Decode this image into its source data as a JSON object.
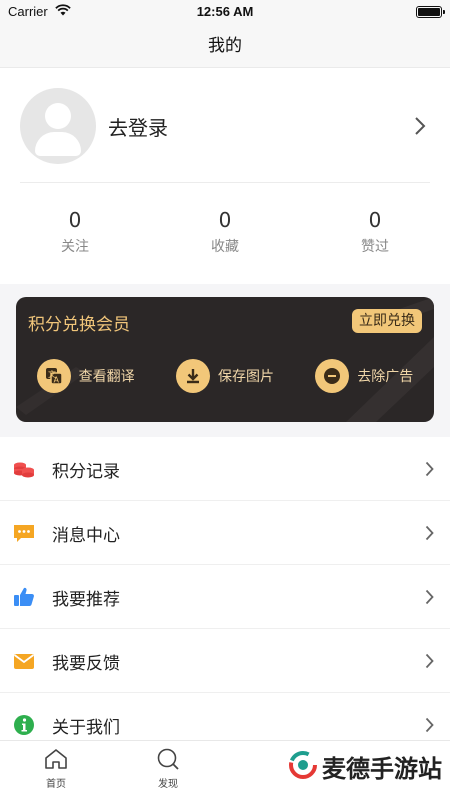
{
  "status_bar": {
    "carrier": "Carrier",
    "time": "12:56 AM"
  },
  "nav": {
    "title": "我的"
  },
  "profile": {
    "login_text": "去登录",
    "stats": [
      {
        "value": "0",
        "label": "关注"
      },
      {
        "value": "0",
        "label": "收藏"
      },
      {
        "value": "0",
        "label": "赞过"
      }
    ]
  },
  "vip": {
    "title": "积分兑换会员",
    "redeem_label": "立即兑换",
    "perks": [
      {
        "label": "查看翻译",
        "icon": "translate-icon"
      },
      {
        "label": "保存图片",
        "icon": "download-icon"
      },
      {
        "label": "去除广告",
        "icon": "remove-ad-icon"
      }
    ]
  },
  "menu": [
    {
      "label": "积分记录",
      "icon": "coins-icon",
      "color": "#f0504f"
    },
    {
      "label": "消息中心",
      "icon": "message-icon",
      "color": "#f5a623"
    },
    {
      "label": "我要推荐",
      "icon": "thumbs-up-icon",
      "color": "#3b8ef5"
    },
    {
      "label": "我要反馈",
      "icon": "mail-icon",
      "color": "#f5a623"
    },
    {
      "label": "关于我们",
      "icon": "info-icon",
      "color": "#2eaf4e"
    }
  ],
  "tabs": [
    {
      "label": "首页",
      "icon": "home-icon"
    },
    {
      "label": "发现",
      "icon": "discover-icon"
    }
  ],
  "watermark": {
    "text": "麦德手游站"
  },
  "colors": {
    "accent_gold": "#f2c779",
    "card_dark": "#2b2727"
  }
}
